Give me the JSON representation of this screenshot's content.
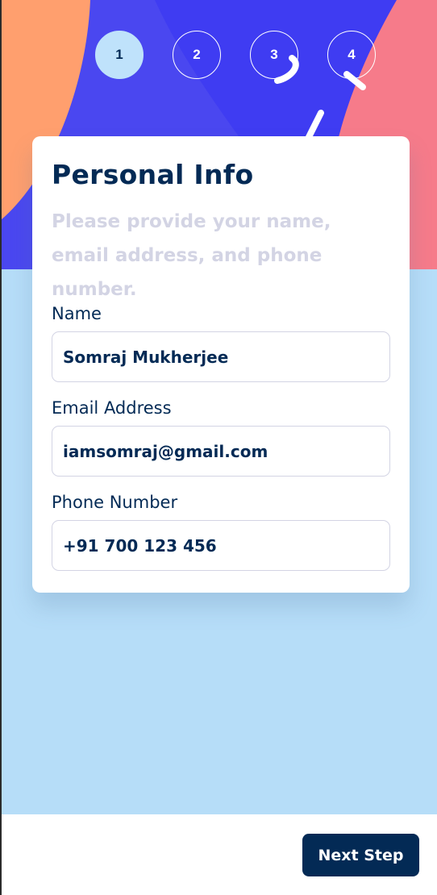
{
  "steps": [
    "1",
    "2",
    "3",
    "4"
  ],
  "active_step": "1",
  "form": {
    "title": "Personal Info",
    "subtitle": "Please provide your name, email address, and phone number.",
    "fields": [
      {
        "label": "Name",
        "value": "Somraj Mukherjee"
      },
      {
        "label": "Email Address",
        "value": "iamsomraj@gmail.com"
      },
      {
        "label": "Phone Number",
        "value": "+91 700 123 456"
      }
    ]
  },
  "footer": {
    "next_label": "Next Step"
  },
  "colors": {
    "primary": "#032a55",
    "hero_blue": "#4a47f0",
    "background": "#b6ddf8",
    "accent_orange": "#ff9f6e",
    "accent_pink": "#f67b8a",
    "muted_text": "#d3d4e4"
  }
}
